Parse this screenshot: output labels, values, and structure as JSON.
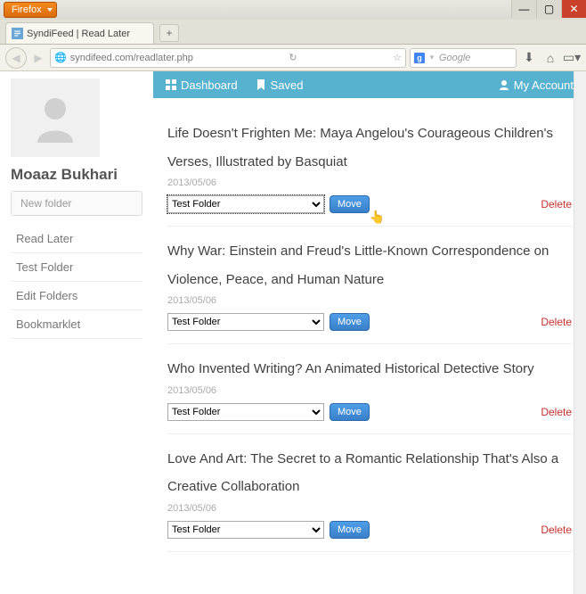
{
  "browser": {
    "menu_label": "Firefox",
    "tab_title": "SyndiFeed | Read Later",
    "url": "syndifeed.com/readlater.php",
    "search_placeholder": "Google"
  },
  "sidebar": {
    "username": "Moaaz Bukhari",
    "new_folder_placeholder": "New folder",
    "items": [
      {
        "label": "Read Later"
      },
      {
        "label": "Test Folder"
      },
      {
        "label": "Edit Folders"
      },
      {
        "label": "Bookmarklet"
      }
    ]
  },
  "topnav": {
    "dashboard": "Dashboard",
    "saved": "Saved",
    "account": "My Account"
  },
  "folder_options": [
    "Test Folder"
  ],
  "move_label": "Move",
  "delete_label": "Delete",
  "articles": [
    {
      "title": "Life Doesn't Frighten Me: Maya Angelou's Courageous Children's Verses, Illustrated by Basquiat",
      "date": "2013/05/06",
      "selected_folder": "Test Folder",
      "focused": true
    },
    {
      "title": "Why War: Einstein and Freud's Little-Known Correspondence on Violence, Peace, and Human Nature",
      "date": "2013/05/06",
      "selected_folder": "Test Folder",
      "focused": false
    },
    {
      "title": "Who Invented Writing? An Animated Historical Detective Story",
      "date": "2013/05/06",
      "selected_folder": "Test Folder",
      "focused": false
    },
    {
      "title": "Love And Art: The Secret to a Romantic Relationship That's Also a Creative Collaboration",
      "date": "2013/05/06",
      "selected_folder": "Test Folder",
      "focused": false
    }
  ]
}
